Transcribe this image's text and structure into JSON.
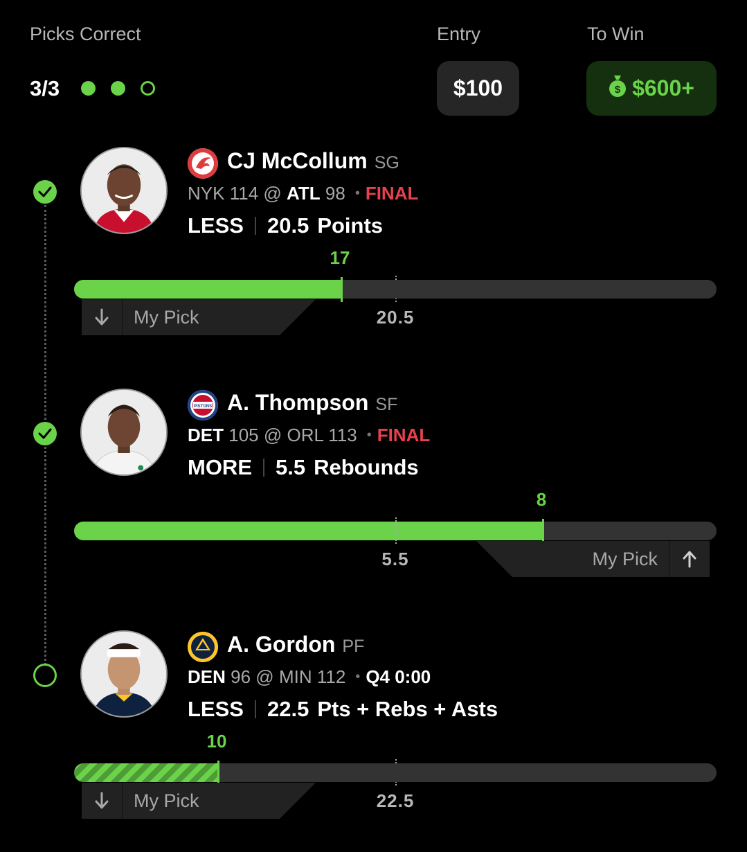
{
  "header": {
    "picks_label": "Picks Correct",
    "entry_label": "Entry",
    "to_win_label": "To Win",
    "picks_count": "3/3",
    "progress_dots": [
      "filled",
      "filled",
      "empty"
    ],
    "entry_amount": "$100",
    "to_win_amount": "$600+",
    "to_win_icon": "money-bag-icon"
  },
  "colors": {
    "accent_green": "#6bd34a",
    "final_red": "#e5424d",
    "pill_bg": "#262626",
    "win_pill_bg": "#15300f"
  },
  "picks": [
    {
      "name": "CJ McCollum",
      "position": "SG",
      "team_logo": "hawks-logo",
      "away_team": "NYK",
      "away_score": "114",
      "at": "@",
      "home_team": "ATL",
      "home_score": "98",
      "status": "FINAL",
      "direction": "LESS",
      "line": "20.5",
      "stat": "Points",
      "current_value": "17",
      "line_label": "20.5",
      "progress_fraction": 0.417,
      "line_fraction": 0.5,
      "my_pick_label": "My Pick",
      "my_pick_side": "left",
      "arrow_icon": "arrow-down-icon",
      "result": "correct"
    },
    {
      "name": "A. Thompson",
      "position": "SF",
      "team_logo": "pistons-logo",
      "away_team": "DET",
      "away_score": "105",
      "at": "@",
      "home_team": "ORL",
      "home_score": "113",
      "status": "FINAL",
      "direction": "MORE",
      "line": "5.5",
      "stat": "Rebounds",
      "current_value": "8",
      "line_label": "5.5",
      "progress_fraction": 0.729,
      "line_fraction": 0.5,
      "my_pick_label": "My Pick",
      "my_pick_side": "right",
      "arrow_icon": "arrow-up-icon",
      "result": "correct"
    },
    {
      "name": "A. Gordon",
      "position": "PF",
      "team_logo": "nuggets-logo",
      "away_team": "DEN",
      "away_score": "96",
      "at": "@",
      "home_team": "MIN",
      "home_score": "112",
      "status": "Q4 0:00",
      "direction": "LESS",
      "line": "22.5",
      "stat": "Pts + Rebs + Asts",
      "current_value": "10",
      "line_label": "22.5",
      "progress_fraction": 0.225,
      "line_fraction": 0.5,
      "my_pick_label": "My Pick",
      "my_pick_side": "left",
      "arrow_icon": "arrow-down-icon",
      "result": "pending"
    }
  ]
}
